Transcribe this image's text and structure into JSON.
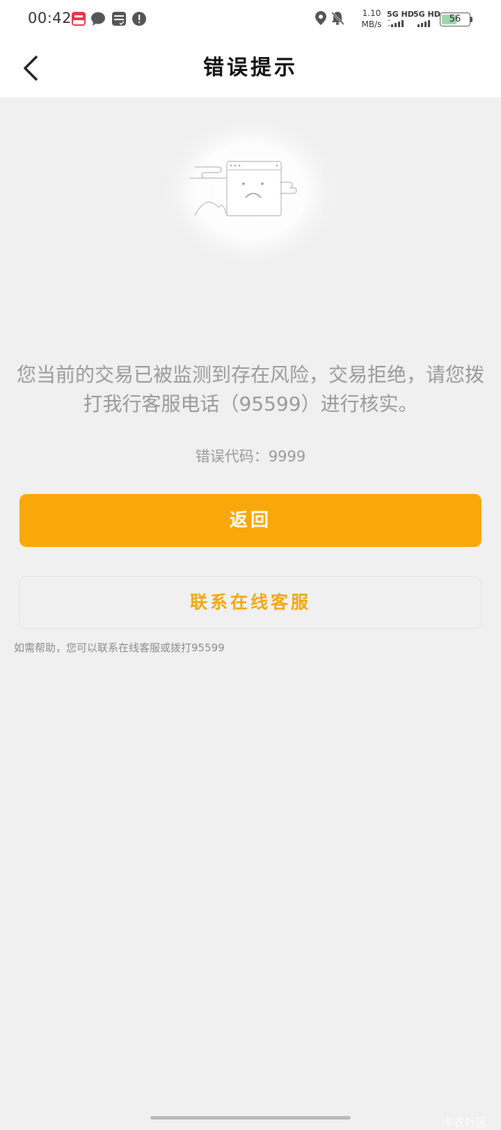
{
  "status_bar": {
    "time": "00:42",
    "net_speed_value": "1.10",
    "net_speed_unit": "MB/s",
    "sim1": "5G HD",
    "sim2": "5G HD",
    "battery": "56",
    "battery_level": 0.56,
    "icons": [
      "app-badge-icon",
      "message-icon",
      "sim-card-icon",
      "alert-icon",
      "location-icon",
      "mute-bell-icon"
    ]
  },
  "header": {
    "title": "错误提示",
    "back_icon": "chevron-left-icon"
  },
  "main": {
    "illustration_icon": "sad-window-icon",
    "message": "您当前的交易已被监测到存在风险，交易拒绝，请您拨打我行客服电话（95599）进行核实。",
    "error_code": "错误代码：9999",
    "back_button": "返回",
    "service_button": "联系在线客服",
    "help_text": "如需帮助，您可以联系在线客服或拨打95599"
  },
  "watermark": "卡农社区",
  "colors": {
    "primary": "#f8a808",
    "background": "#f0f0f0",
    "text_muted": "#9a9a9a"
  }
}
